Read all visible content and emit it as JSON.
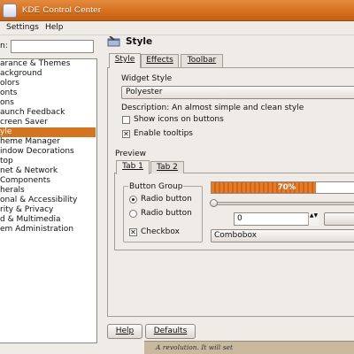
{
  "window": {
    "title": "KDE Control Center"
  },
  "menubar": {
    "settings": "Settings",
    "help": "Help"
  },
  "sidebar": {
    "search_label": "n:",
    "search_value": "",
    "items": [
      "arance & Themes",
      "ackground",
      "olors",
      "onts",
      "ons",
      "aunch Feedback",
      "creen Saver",
      "yle",
      "heme Manager",
      "indow Decorations",
      "top",
      "net & Network",
      "Components",
      "herals",
      "onal & Accessibility",
      "rity & Privacy",
      "d & Multimedia",
      "em Administration"
    ],
    "selected_index": 7
  },
  "header": {
    "title": "Style"
  },
  "tabs": [
    "Style",
    "Effects",
    "Toolbar"
  ],
  "widget_style": {
    "group_title": "Widget Style",
    "selected": "Polyester",
    "description": "Description: An almost simple and clean style",
    "show_icons": {
      "label": "Show icons on buttons",
      "checked": false
    },
    "enable_tooltips": {
      "label": "Enable tooltips",
      "checked": true
    }
  },
  "preview": {
    "title": "Preview",
    "tabs": [
      "Tab 1",
      "Tab 2"
    ],
    "button_group": "Button Group",
    "radio1": "Radio button",
    "radio2": "Radio button",
    "checkbox": "Checkbox",
    "progress_text": "70%",
    "progress_value": 0.7,
    "spin_value": "0",
    "spin_arrows": "▲▼",
    "combobox": "Combobox"
  },
  "buttons": {
    "help": "Help",
    "defaults": "Defaults"
  },
  "doc_peek": {
    "text": "A revolution. It will set"
  }
}
